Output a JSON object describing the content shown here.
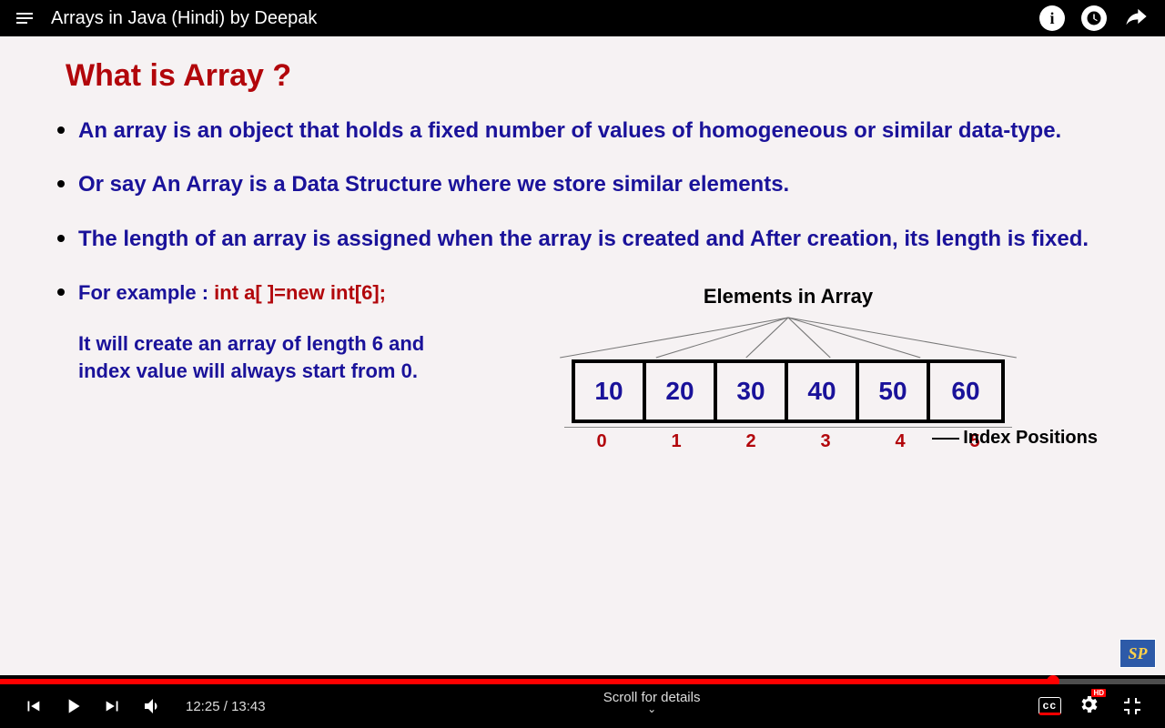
{
  "top": {
    "title": "Arrays in Java (Hindi) by Deepak",
    "info_label": "i"
  },
  "slide": {
    "heading": "What is Array ?",
    "bullets": [
      "An array is an object that holds a fixed number of values of homogeneous or similar data-type.",
      "Or say An Array is a Data Structure where we store similar elements.",
      "The length of an array is assigned when the array is created and After creation, its length is fixed."
    ],
    "example_intro_prefix": "For example : ",
    "example_code": "int a[ ]=new int[6];",
    "example_desc": "It will create an array of length 6 and index value will always start from 0.",
    "diagram": {
      "title": "Elements in Array",
      "values": [
        "10",
        "20",
        "30",
        "40",
        "50",
        "60"
      ],
      "indices": [
        "0",
        "1",
        "2",
        "3",
        "4",
        "5"
      ],
      "index_label": "Index Positions"
    },
    "logo": "SP"
  },
  "controls": {
    "current": "12:25",
    "sep": " / ",
    "total": "13:43",
    "scroll_hint": "Scroll for details",
    "cc": "cc",
    "hd": "HD"
  }
}
